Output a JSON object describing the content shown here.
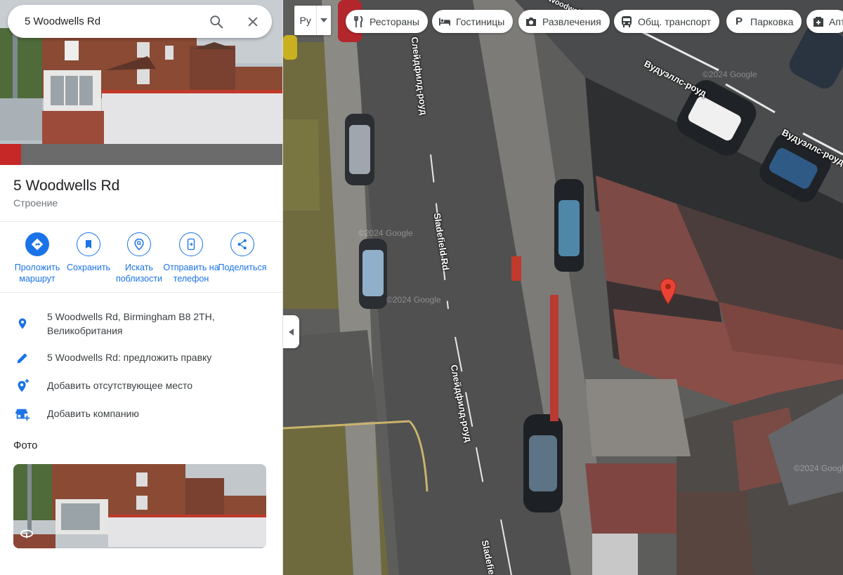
{
  "search": {
    "value": "5 Woodwells Rd",
    "icons": [
      "search-icon",
      "close-icon"
    ]
  },
  "place": {
    "title": "5 Woodwells Rd",
    "subtitle": "Строение"
  },
  "actions": [
    {
      "label": "Проложить маршрут",
      "icon": "directions-icon"
    },
    {
      "label": "Сохранить",
      "icon": "bookmark-icon"
    },
    {
      "label": "Искать поблизости",
      "icon": "nearby-icon"
    },
    {
      "label": "Отправить на телефон",
      "icon": "send-to-phone-icon"
    },
    {
      "label": "Поделиться",
      "icon": "share-icon"
    }
  ],
  "info": [
    {
      "text": "5 Woodwells Rd, Birmingham B8 2TH, Великобритания",
      "icon": "location-pin-icon"
    },
    {
      "text": "5 Woodwells Rd: предложить правку",
      "icon": "pencil-icon"
    },
    {
      "text": "Добавить отсутствующее место",
      "icon": "add-place-icon"
    },
    {
      "text": "Добавить компанию",
      "icon": "add-business-icon"
    }
  ],
  "photos": {
    "heading": "Фото"
  },
  "map": {
    "language_button": "Ру",
    "chips": [
      {
        "label": "Рестораны",
        "icon": "restaurant-icon"
      },
      {
        "label": "Гостиницы",
        "icon": "hotel-icon"
      },
      {
        "label": "Развлечения",
        "icon": "camera-icon"
      },
      {
        "label": "Общ. транспорт",
        "icon": "transit-icon"
      },
      {
        "label": "Парковка",
        "icon": "parking-icon"
      },
      {
        "label": "Апт",
        "icon": "pharmacy-icon"
      }
    ],
    "streets": [
      {
        "label": "Слейдфилд-роуд"
      },
      {
        "label": "Sladefield Rd"
      },
      {
        "label": "Слейдфилд-роуд"
      },
      {
        "label": "Sladefie"
      },
      {
        "label": "Вудуэллс-роуд"
      },
      {
        "label": "Вудуэллс-роуд"
      },
      {
        "label": "Woodwells Rd"
      }
    ],
    "watermarks": [
      "©2024 Google",
      "©2024 Google",
      "©2024 Google",
      "©2024 Google"
    ]
  },
  "colors": {
    "accent": "#1a73e8",
    "pin": "#ea4335",
    "text": "#202124",
    "muted": "#70757a"
  }
}
